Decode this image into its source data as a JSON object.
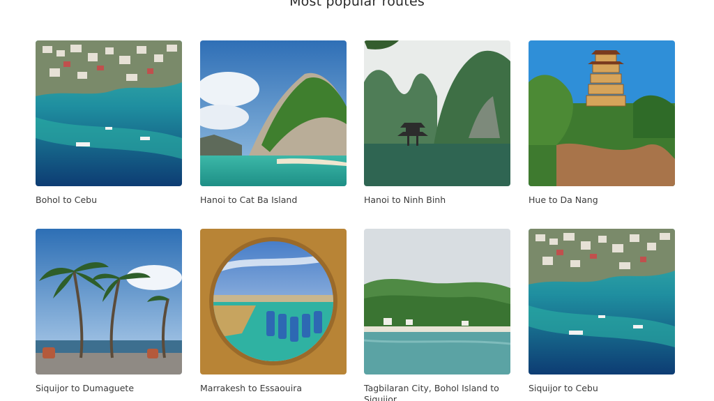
{
  "section": {
    "title": "Most popular routes"
  },
  "routes": [
    {
      "label": "Bohol to Cebu",
      "image": "aerial-coastal-village-photo"
    },
    {
      "label": "Hanoi to Cat Ba Island",
      "image": "limestone-island-beach-photo"
    },
    {
      "label": "Hanoi to Ninh Binh",
      "image": "karst-river-pavilion-photo"
    },
    {
      "label": "Hue to Da Nang",
      "image": "pagoda-tower-photo"
    },
    {
      "label": "Siquijor to Dumaguete",
      "image": "palm-tree-promenade-photo"
    },
    {
      "label": "Marrakesh to Essaouira",
      "image": "harbor-through-stone-window-photo"
    },
    {
      "label": "Tagbilaran City, Bohol Island to Siquijor",
      "image": "green-hills-coast-photo"
    },
    {
      "label": "Siquijor to Cebu",
      "image": "aerial-coastal-village-photo"
    }
  ]
}
